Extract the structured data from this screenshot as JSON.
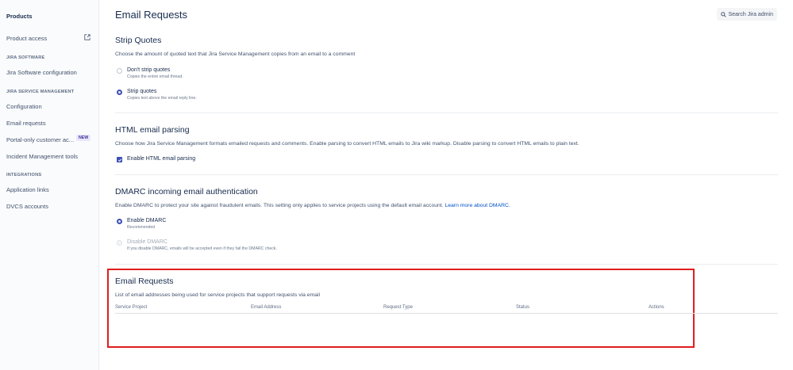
{
  "sidebar": {
    "title": "Products",
    "product_access": "Product access",
    "jira_software_heading": "JIRA SOFTWARE",
    "jira_software_config": "Jira Software configuration",
    "jsm_heading": "JIRA SERVICE MANAGEMENT",
    "configuration": "Configuration",
    "email_requests": "Email requests",
    "portal_only": "Portal-only customer ac...",
    "new_badge": "NEW",
    "incident_tools": "Incident Management tools",
    "integrations_heading": "INTEGRATIONS",
    "application_links": "Application links",
    "dvcs_accounts": "DVCS accounts"
  },
  "header": {
    "title": "Email Requests",
    "search_label": "Search Jira admin"
  },
  "strip_quotes": {
    "title": "Strip Quotes",
    "description": "Choose the amount of quoted text that Jira Service Management copies from an email to a comment",
    "options": [
      {
        "label": "Don't strip quotes",
        "hint": "Copies the entire email thread.",
        "selected": false
      },
      {
        "label": "Strip quotes",
        "hint": "Copies text above the email reply line.",
        "selected": true
      }
    ]
  },
  "html_parsing": {
    "title": "HTML email parsing",
    "description": "Choose how Jira Service Management formats emailed requests and comments. Enable parsing to convert HTML emails to Jira wiki markup. Disable parsing to convert HTML emails to plain text.",
    "checkbox_label": "Enable HTML email parsing",
    "checked": true
  },
  "dmarc": {
    "title": "DMARC incoming email authentication",
    "description": "Enable DMARC to protect your site against fraudulent emails. This setting only applies to service projects using the default email account.",
    "link": "Learn more about DMARC.",
    "options": [
      {
        "label": "Enable DMARC",
        "hint": "Recommended",
        "selected": true
      },
      {
        "label": "Disable DMARC",
        "hint": "If you disable DMARC, emails will be accepted even if they fail the DMARC check.",
        "selected": false
      }
    ]
  },
  "email_requests": {
    "title": "Email Requests",
    "description": "List of email addresses being used for service projects that support requests via email",
    "columns": [
      "Service Project",
      "Email Address",
      "Request Type",
      "Status",
      "Actions"
    ]
  },
  "colors": {
    "accent": "#3F51B5",
    "link": "#0052CC",
    "highlight_border": "#E01E1E"
  }
}
